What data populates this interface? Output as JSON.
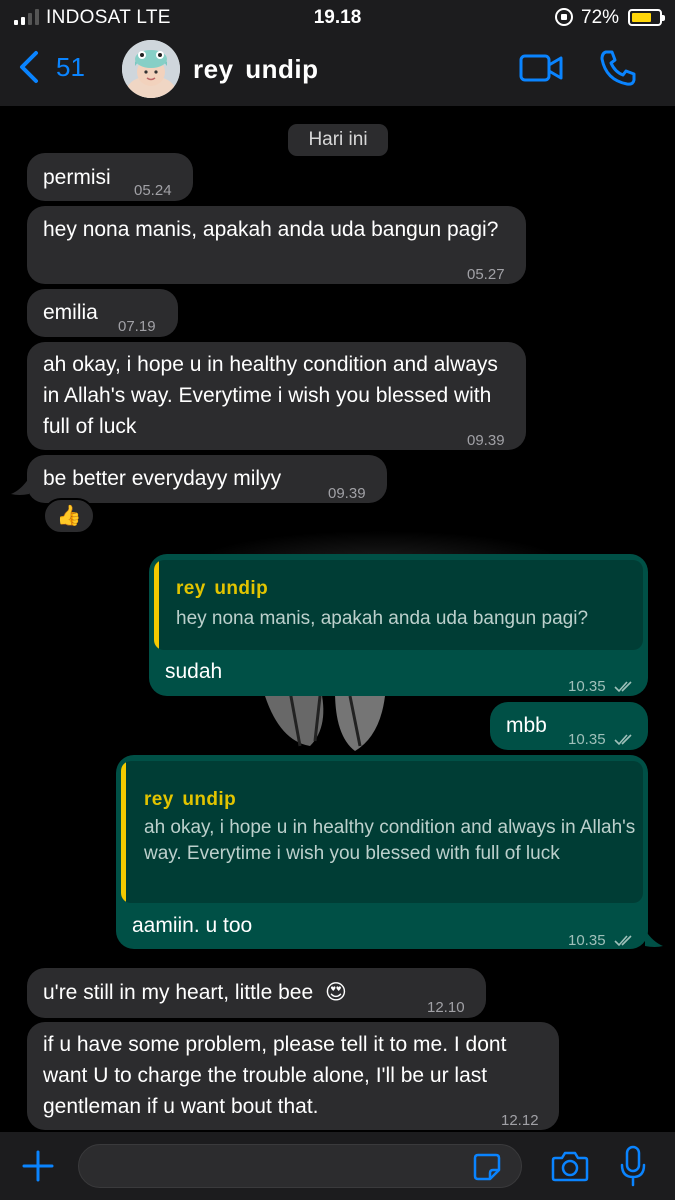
{
  "status_bar": {
    "carrier": "INDOSAT  LTE",
    "time": "19.18",
    "battery_percent": "72%",
    "battery_level": 0.72,
    "signal_bars_active": 2,
    "signal_bars_total": 4,
    "battery_color": "#ffd60a"
  },
  "header": {
    "back_count": "51",
    "contact_name": "rey  undip",
    "accent_color": "#0a84ff"
  },
  "chat": {
    "date_label": "Hari ini",
    "messages": [
      {
        "text": "permisi",
        "time": "05.24"
      },
      {
        "text": "hey nona manis, apakah anda uda bangun pagi?",
        "time": "05.27"
      },
      {
        "text": "emilia",
        "time": "07.19"
      },
      {
        "text": "ah okay, i hope u in healthy condition and always in Allah's way. Everytime i wish you blessed with full of luck",
        "time": "09.39"
      },
      {
        "text": "be better everydayy milyy",
        "time": "09.39",
        "reaction": "👍"
      },
      {
        "text": "sudah",
        "time": "10.35",
        "quote_name": "rey  undip",
        "quote_text": "hey nona manis, apakah anda uda bangun pagi?"
      },
      {
        "text": "mbb",
        "time": "10.35"
      },
      {
        "text": "aamiin. u too",
        "time": "10.35",
        "quote_name": "rey  undip",
        "quote_text": "ah okay, i hope u in healthy condition and always in Allah's way. Everytime i wish you blessed with full of luck"
      },
      {
        "text": "u're still in my heart, little bee",
        "emoji": "😍",
        "time": "12.10"
      },
      {
        "text": "if u have some problem, please tell it to me. I dont want U to charge the trouble alone, I'll be ur last gentleman if u want bout that.",
        "time": "12.12"
      }
    ]
  },
  "input": {
    "placeholder": ""
  },
  "colors": {
    "incoming_bubble": "#2c2c2e",
    "outgoing_bubble": "#005046",
    "quote_bar": "#f5ca00"
  }
}
